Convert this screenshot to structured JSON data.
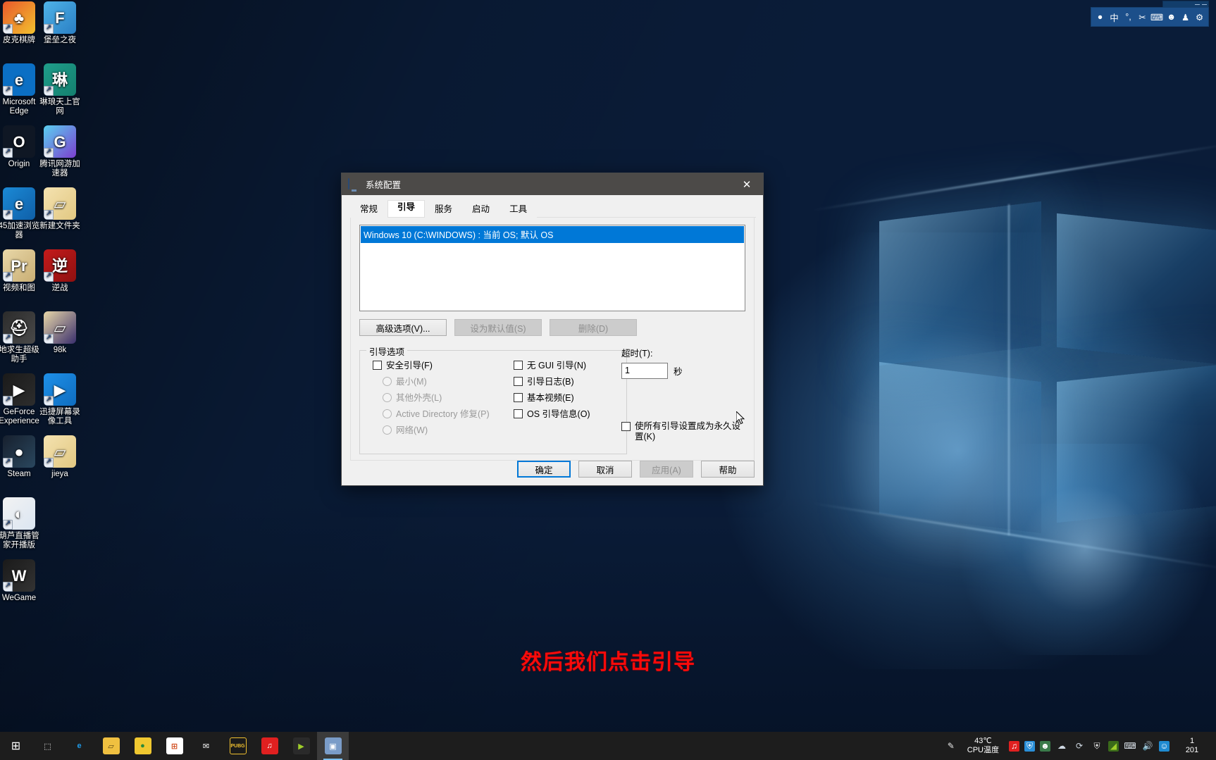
{
  "desktop": {
    "icons_col1": [
      {
        "label": "皮克棋牌",
        "color1": "#e8582c",
        "color2": "#f2c12e",
        "glyph": "♣"
      },
      {
        "label": "Microsoft Edge",
        "color1": "#0b6fc4",
        "color2": "#0b6fc4",
        "glyph": "e"
      },
      {
        "label": "Origin",
        "color1": "#0f1724",
        "color2": "#0f1724",
        "glyph": "O"
      },
      {
        "label": "45加速浏览器",
        "color1": "#1b8ad6",
        "color2": "#0f5fa8",
        "glyph": "e"
      },
      {
        "label": "视频和图",
        "color1": "#e8d7a8",
        "color2": "#c9ae74",
        "glyph": "Pr"
      },
      {
        "label": "地求生超级助手",
        "color1": "#2b2b2b",
        "color2": "#4a4a4a",
        "glyph": "⛑"
      },
      {
        "label": "GeForce Experience",
        "color1": "#1a1a1a",
        "color2": "#2d2d2d",
        "glyph": "▶"
      },
      {
        "label": "Steam",
        "color1": "#17202e",
        "color2": "#2a475e",
        "glyph": "●"
      },
      {
        "label": "葫芦直播管家开播版",
        "color1": "#f2f2f2",
        "color2": "#dbe6f2",
        "glyph": "◐"
      },
      {
        "label": "WeGame",
        "color1": "#1a1a1a",
        "color2": "#333333",
        "glyph": "W"
      }
    ],
    "icons_col2": [
      {
        "label": "堡垒之夜",
        "color1": "#4fb3e8",
        "color2": "#2a7fc4",
        "glyph": "F"
      },
      {
        "label": "琳琅天上官网",
        "color1": "#1f9d8a",
        "color2": "#14806f",
        "glyph": "琳"
      },
      {
        "label": "腾讯网游加速器",
        "color1": "#5ad0f0",
        "color2": "#7c3fd0",
        "glyph": "G"
      },
      {
        "label": "新建文件夹",
        "color1": "#f4e2b0",
        "color2": "#e2c882",
        "glyph": "▱"
      },
      {
        "label": "逆战",
        "color1": "#c41b1b",
        "color2": "#8e1010",
        "glyph": "逆"
      },
      {
        "label": "98k",
        "color1": "#e8d7a8",
        "color2": "#3a2f6d",
        "glyph": "▱"
      },
      {
        "label": "迅捷屏幕录像工具",
        "color1": "#1e90e8",
        "color2": "#0f6dc0",
        "glyph": "▶"
      },
      {
        "label": "jieya",
        "color1": "#f4e2b0",
        "color2": "#e2c882",
        "glyph": "▱"
      }
    ]
  },
  "ime_bar": {
    "items": [
      {
        "name": "ime-logo-icon",
        "glyph": "●"
      },
      {
        "name": "ime-chinese-mode-icon",
        "glyph": "中"
      },
      {
        "name": "ime-punctuation-icon",
        "glyph": "°,"
      },
      {
        "name": "ime-screenshot-scissors-icon",
        "glyph": "✂"
      },
      {
        "name": "ime-soft-keyboard-icon",
        "glyph": "⌨"
      },
      {
        "name": "ime-user-icon",
        "glyph": "☻"
      },
      {
        "name": "ime-skin-icon",
        "glyph": "♟"
      },
      {
        "name": "ime-settings-gear-icon",
        "glyph": "⚙"
      }
    ]
  },
  "dialog": {
    "title": "系统配置",
    "close_label": "✕",
    "tabs": [
      {
        "label": "常规",
        "active": false
      },
      {
        "label": "引导",
        "active": true
      },
      {
        "label": "服务",
        "active": false
      },
      {
        "label": "启动",
        "active": false
      },
      {
        "label": "工具",
        "active": false
      }
    ],
    "os_list": {
      "selected_row": "Windows 10 (C:\\WINDOWS) : 当前 OS; 默认 OS"
    },
    "list_buttons": [
      {
        "label": "高级选项(V)...",
        "disabled": false
      },
      {
        "label": "设为默认值(S)",
        "disabled": true
      },
      {
        "label": "删除(D)",
        "disabled": true
      }
    ],
    "boot_options": {
      "title": "引导选项",
      "left_column": [
        {
          "label": "安全引导(F)",
          "type": "checkbox",
          "checked": false,
          "disabled": false
        },
        {
          "label": "最小(M)",
          "type": "radio",
          "checked": false,
          "disabled": true
        },
        {
          "label": "其他外壳(L)",
          "type": "radio",
          "checked": false,
          "disabled": true
        },
        {
          "label": "Active Directory 修复(P)",
          "type": "radio",
          "checked": false,
          "disabled": true
        },
        {
          "label": "网络(W)",
          "type": "radio",
          "checked": false,
          "disabled": true
        }
      ],
      "right_column": [
        {
          "label": "无 GUI 引导(N)",
          "type": "checkbox",
          "checked": false,
          "disabled": false
        },
        {
          "label": "引导日志(B)",
          "type": "checkbox",
          "checked": false,
          "disabled": false
        },
        {
          "label": "基本视频(E)",
          "type": "checkbox",
          "checked": false,
          "disabled": false
        },
        {
          "label": "OS 引导信息(O)",
          "type": "checkbox",
          "checked": false,
          "disabled": false
        }
      ]
    },
    "timeout": {
      "label": "超时(T):",
      "value": "1",
      "unit": "秒",
      "permanent_checkbox": "使所有引导设置成为永久设置(K)"
    },
    "footer_buttons": [
      {
        "label": "确定",
        "default": true,
        "disabled": false
      },
      {
        "label": "取消",
        "default": false,
        "disabled": false
      },
      {
        "label": "应用(A)",
        "default": false,
        "disabled": true
      },
      {
        "label": "帮助",
        "default": false,
        "disabled": false
      }
    ]
  },
  "subtitle": "然后我们点击引导",
  "taskbar": {
    "start_label": "⊞",
    "apps": [
      {
        "name": "taskbar-task-view",
        "glyph": "⬚",
        "bg": "transparent",
        "fg": "#ffffff"
      },
      {
        "name": "taskbar-edge",
        "glyph": "e",
        "bg": "transparent",
        "fg": "#1e9ae8"
      },
      {
        "name": "taskbar-file-explorer",
        "glyph": "▱",
        "bg": "#f0c040",
        "fg": "#5a4410"
      },
      {
        "name": "taskbar-360-browser",
        "glyph": "●",
        "bg": "#f0c830",
        "fg": "#2a8a3a"
      },
      {
        "name": "taskbar-microsoft-store",
        "glyph": "⊞",
        "bg": "#ffffff",
        "fg": "#d04a1a"
      },
      {
        "name": "taskbar-mail",
        "glyph": "✉",
        "bg": "transparent",
        "fg": "#ffffff"
      },
      {
        "name": "taskbar-pubg",
        "glyph": "PUBG",
        "bg": "#1a1a1a",
        "fg": "#f0c030"
      },
      {
        "name": "taskbar-netease-music",
        "glyph": "♫",
        "bg": "#e02020",
        "fg": "#ffffff"
      },
      {
        "name": "taskbar-geforce-experience",
        "glyph": "▶",
        "bg": "#2a2a2a",
        "fg": "#9fce2a"
      },
      {
        "name": "taskbar-system-configuration",
        "glyph": "▣",
        "bg": "#7a9cc8",
        "fg": "#ffffff",
        "active": true
      }
    ],
    "tray": {
      "pen_icon": "✎",
      "cpu_temp_value": "43℃",
      "cpu_temp_label": "CPU温度",
      "icons": [
        {
          "name": "tray-netease-music-icon",
          "glyph": "♫",
          "bg": "#e02020",
          "fg": "#fff"
        },
        {
          "name": "tray-security-shield-icon",
          "glyph": "⛨",
          "bg": "#2a8fd8",
          "fg": "#fff"
        },
        {
          "name": "tray-assistant-icon",
          "glyph": "☻",
          "bg": "#3a7a4a",
          "fg": "#fff"
        },
        {
          "name": "tray-network-wifi-icon",
          "glyph": "☁",
          "bg": "transparent",
          "fg": "#cfd8e2"
        },
        {
          "name": "tray-satellite-icon",
          "glyph": "⟳",
          "bg": "transparent",
          "fg": "#cfd8e2"
        },
        {
          "name": "tray-windows-defender-icon",
          "glyph": "⛨",
          "bg": "transparent",
          "fg": "#e8e8e8"
        },
        {
          "name": "tray-nvidia-icon",
          "glyph": "◢",
          "bg": "#3a6a1a",
          "fg": "#9fce2a"
        },
        {
          "name": "tray-network-status-icon",
          "glyph": "⌨",
          "bg": "transparent",
          "fg": "#dfe6ee"
        },
        {
          "name": "tray-volume-icon",
          "glyph": "🔊",
          "bg": "transparent",
          "fg": "#dfe6ee"
        },
        {
          "name": "tray-qq-icon",
          "glyph": "☺",
          "bg": "#1f8ad0",
          "fg": "#fff"
        }
      ],
      "clock_line1": "1",
      "clock_line2": "201"
    }
  }
}
